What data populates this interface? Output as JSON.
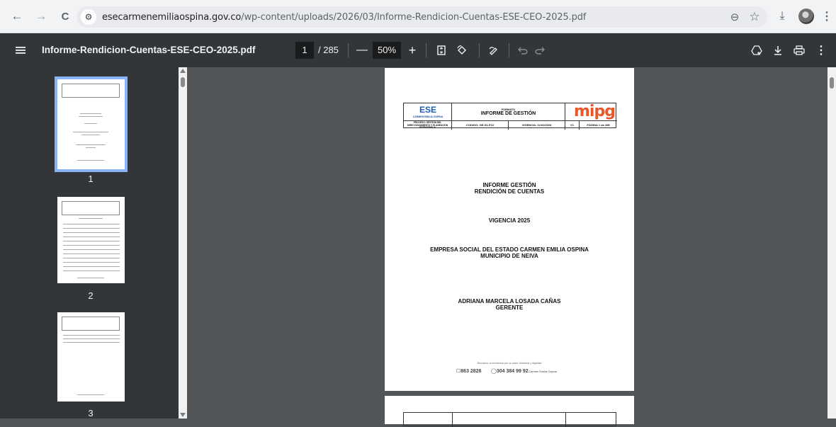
{
  "browser": {
    "back": "←",
    "forward": "→",
    "reload": "C",
    "site_info": "⚙",
    "url_host": "esecarmenemiliaospina.gov.co",
    "url_path": "/wp-content/uploads/2026/03/Informe-Rendicion-Cuentas-ESE-CEO-2025.pdf",
    "zoom_icon": "⊖",
    "star_icon": "☆",
    "download_icon": "⤓",
    "menu_icon": "⋮"
  },
  "pdf": {
    "title": "Informe-Rendicion-Cuentas-ESE-CEO-2025.pdf",
    "page_current": "1",
    "page_total": "/ 285",
    "zoom": "50%",
    "minus": "—",
    "plus": "+"
  },
  "thumbnails": [
    {
      "num": "1"
    },
    {
      "num": "2"
    },
    {
      "num": "3"
    }
  ],
  "page": {
    "ese_caption": "CARMEN EMILIA OSPINA",
    "format_label": "FORMATO",
    "format_title": "INFORME DE GESTIÓN",
    "mipg": "mipg",
    "row2": {
      "proceso": "PROCESO: GESTIÓN DEL DIRECCIONAMIENTO Y PLANEACIÓN ESTRATÉGICA",
      "codigo": "CODIGO: GE-S1-F10",
      "vigencia": "VIGENCIA: 11/01/2023",
      "version": "V1",
      "pagina": "PÁGINA 1 de 285"
    },
    "heading_1": "INFORME GESTIÓN",
    "heading_2": "RENDICIÓN DE CUENTAS",
    "vigencia": "VIGENCIA 2025",
    "empresa_1": "EMPRESA SOCIAL DEL ESTADO CARMEN EMILIA OSPINA",
    "empresa_2": "MUNICIPIO DE NEIVA",
    "gerente_name": "ADRIANA MARCELA LOSADA CAÑAS",
    "gerente_role": "GERENTE",
    "slogan": "Buscamos la excelencia por su salud, bienestar y dignidad",
    "phone1": "863 2826",
    "phone2": "304 384 99 92",
    "social": "Carmen Emilia Ospina"
  }
}
